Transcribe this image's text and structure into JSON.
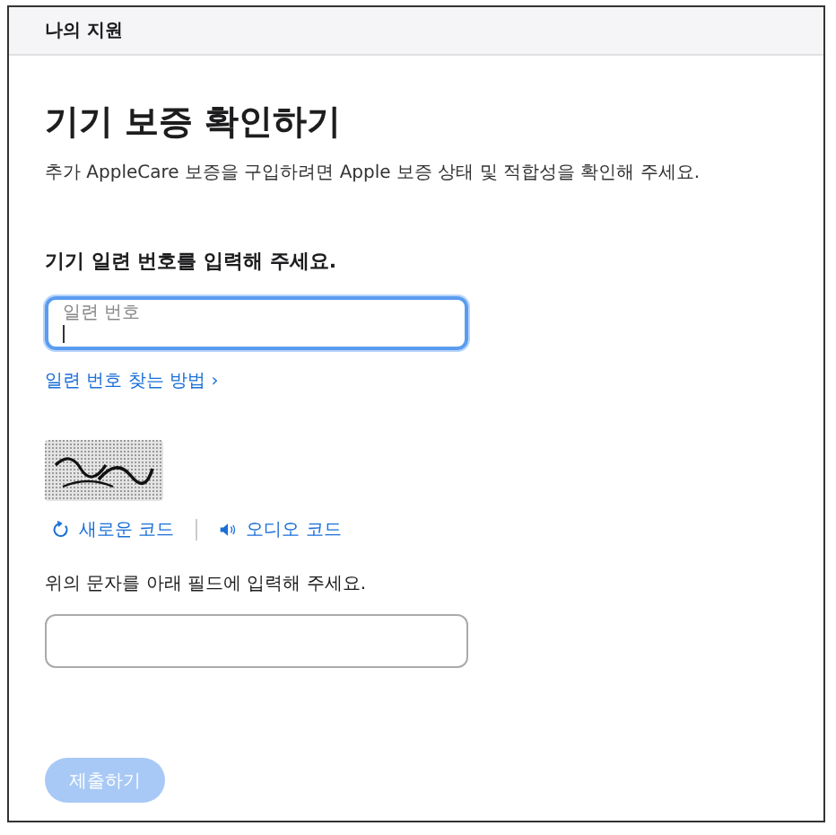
{
  "header": {
    "title": "나의 지원"
  },
  "page": {
    "title": "기기 보증 확인하기",
    "description": "추가 AppleCare 보증을 구입하려면 Apple 보증 상태 및 적합성을 확인해 주세요."
  },
  "serial_section": {
    "heading": "기기 일련 번호를 입력해 주세요.",
    "field": {
      "label": "일련 번호",
      "focused": true
    },
    "help_link": "일련 번호 찾는 방법 ›"
  },
  "captcha": {
    "refresh_link": "새로운 코드",
    "audio_link": "오디오 코드",
    "instruction": "위의 문자를 아래 필드에 입력해 주세요.",
    "field": {
      "focused": false
    }
  },
  "submit_button": {
    "label": "제출하기",
    "disabled": true
  }
}
